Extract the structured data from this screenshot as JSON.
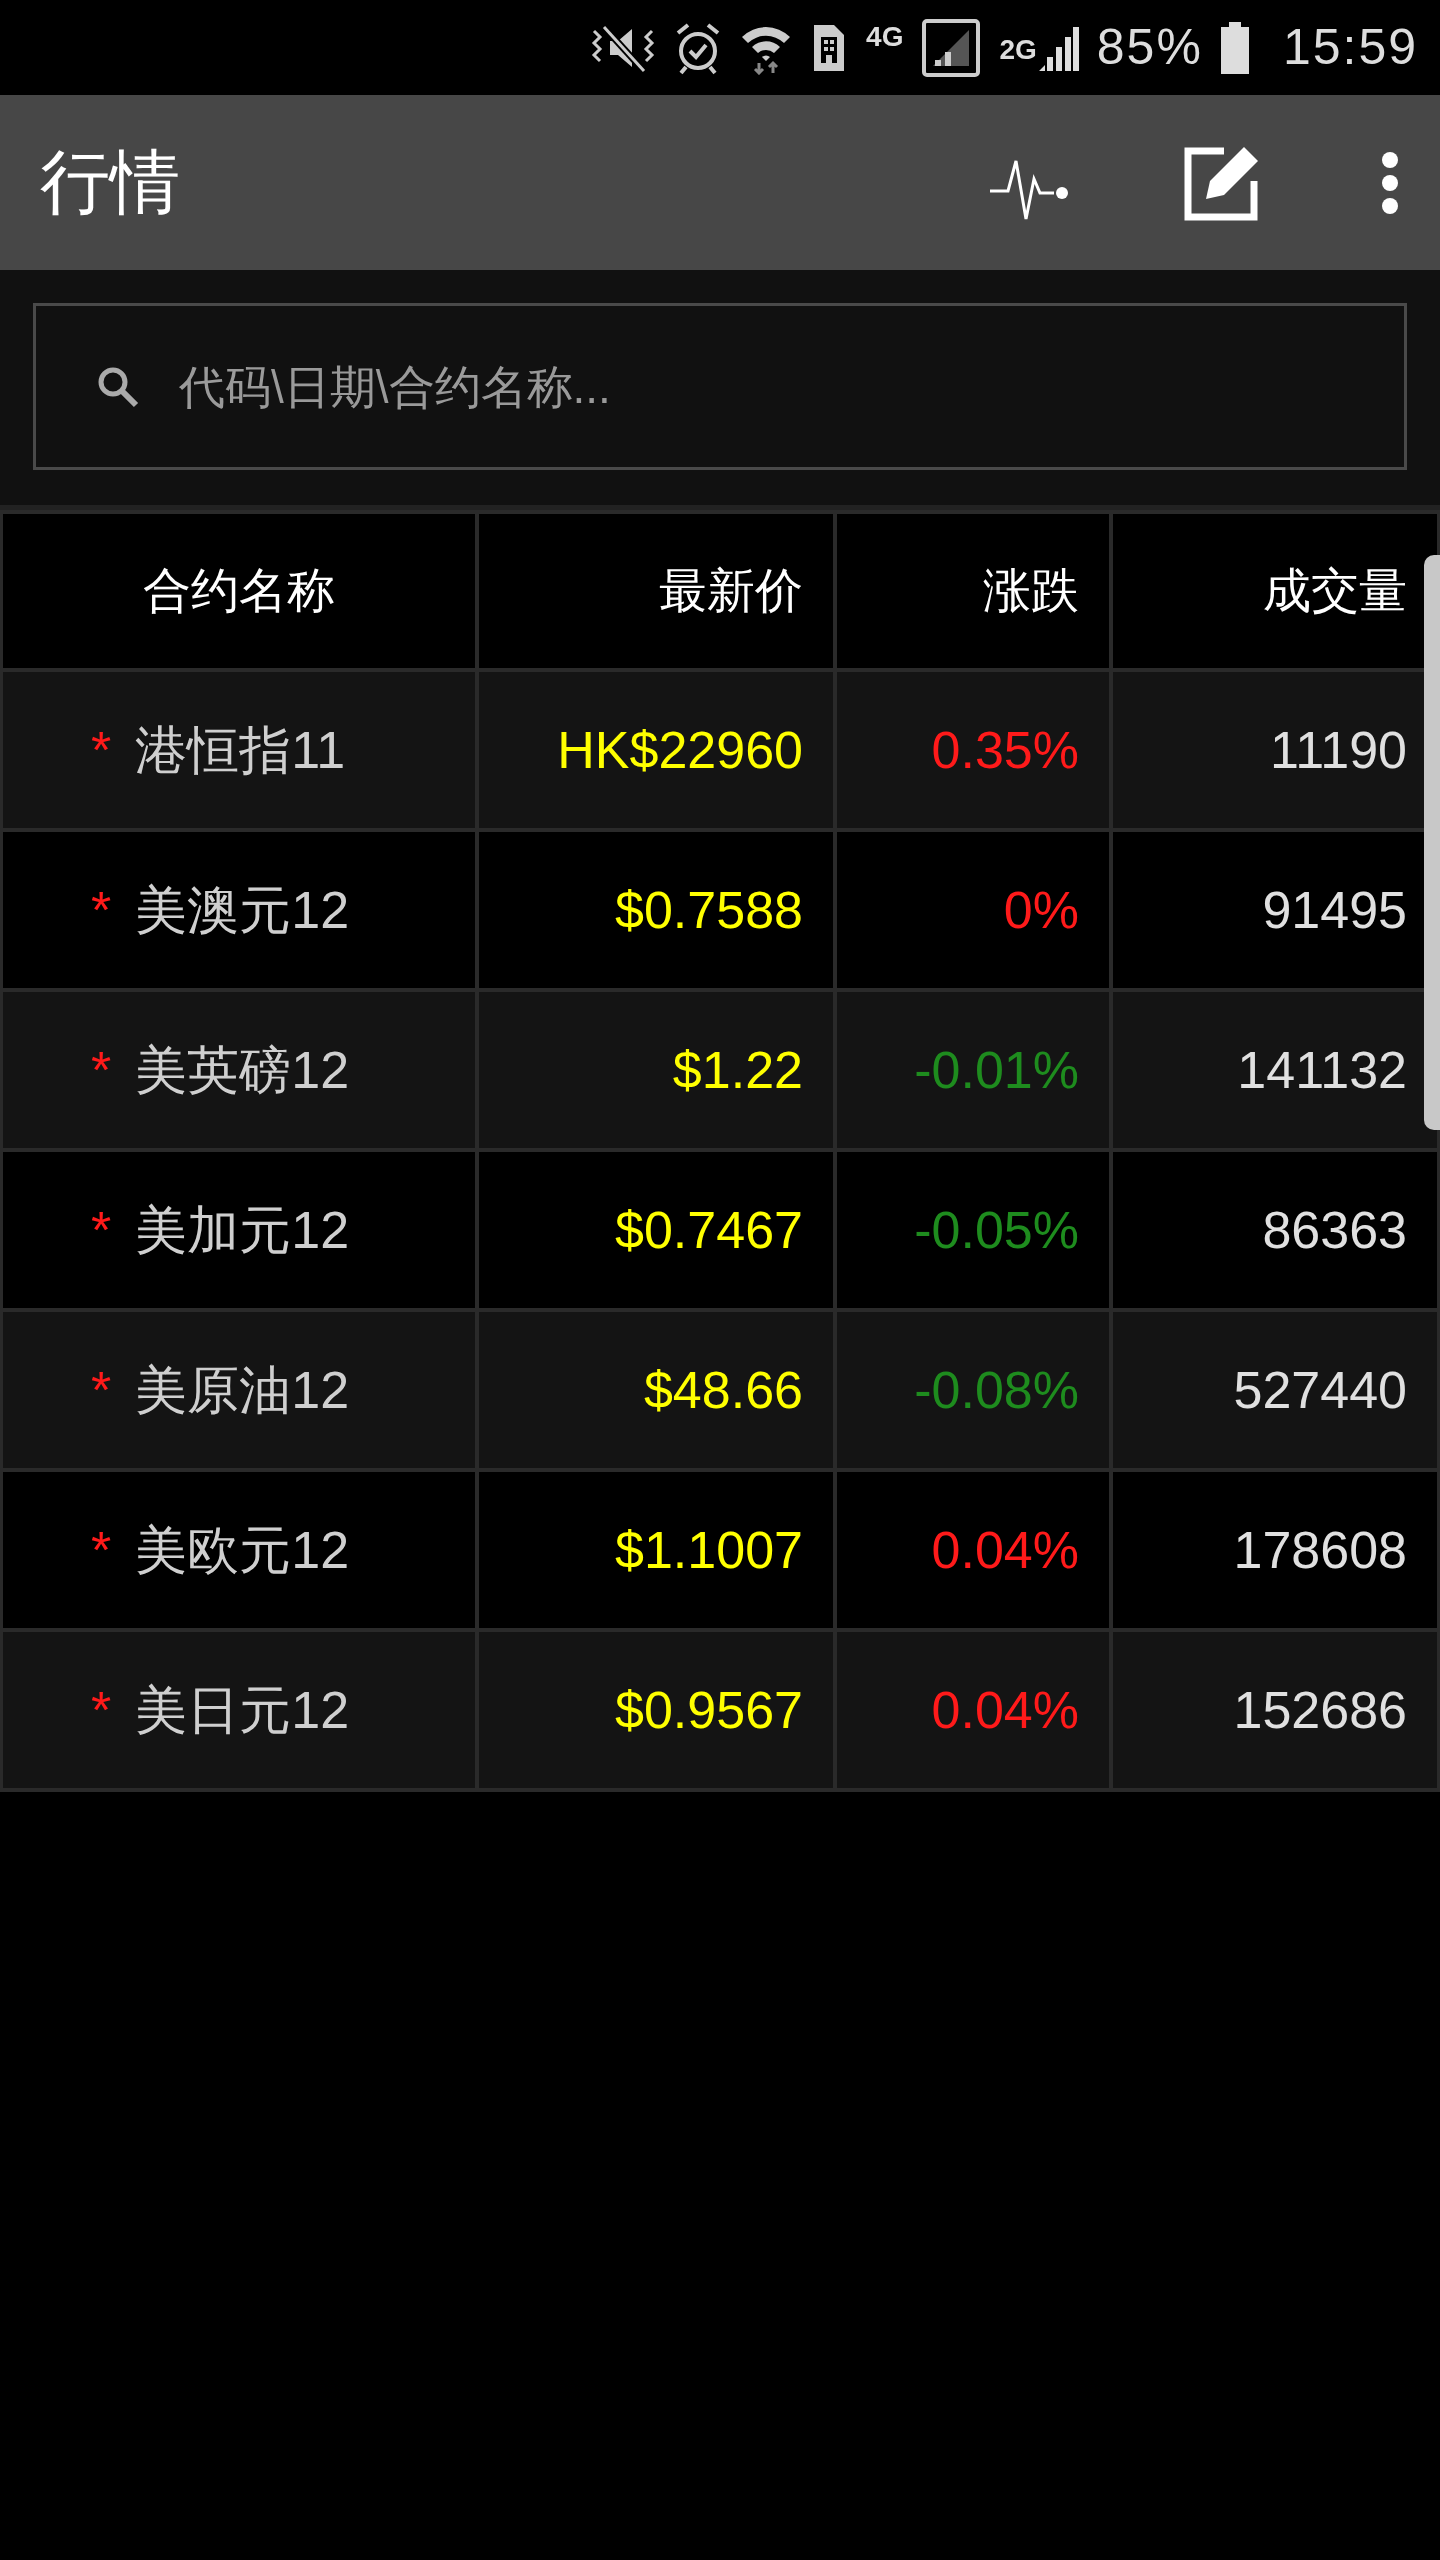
{
  "status_bar": {
    "network_4g": "4G",
    "network_2g": "2G",
    "battery": "85%",
    "time": "15:59"
  },
  "app_bar": {
    "title": "行情"
  },
  "search": {
    "placeholder": "代码\\日期\\合约名称..."
  },
  "table": {
    "columns": [
      "合约名称",
      "最新价",
      "涨跌",
      "成交量"
    ],
    "rows": [
      {
        "mark": "*",
        "name": "港恒指11",
        "price": "HK$22960",
        "change": "0.35%",
        "color": "#ff1a1a",
        "volume": "11190"
      },
      {
        "mark": "*",
        "name": "美澳元12",
        "price": "$0.7588",
        "change": "0%",
        "color": "#ff1a1a",
        "volume": "91495"
      },
      {
        "mark": "*",
        "name": "美英磅12",
        "price": "$1.22",
        "change": "-0.01%",
        "color": "#1e8c1e",
        "volume": "141132"
      },
      {
        "mark": "*",
        "name": "美加元12",
        "price": "$0.7467",
        "change": "-0.05%",
        "color": "#1e8c1e",
        "volume": "86363"
      },
      {
        "mark": "*",
        "name": "美原油12",
        "price": "$48.66",
        "change": "-0.08%",
        "color": "#1e8c1e",
        "volume": "527440"
      },
      {
        "mark": "*",
        "name": "美欧元12",
        "price": "$1.1007",
        "change": "0.04%",
        "color": "#ff1a1a",
        "volume": "178608"
      },
      {
        "mark": "*",
        "name": "美日元12",
        "price": "$0.9567",
        "change": "0.04%",
        "color": "#ff1a1a",
        "volume": "152686"
      }
    ]
  }
}
